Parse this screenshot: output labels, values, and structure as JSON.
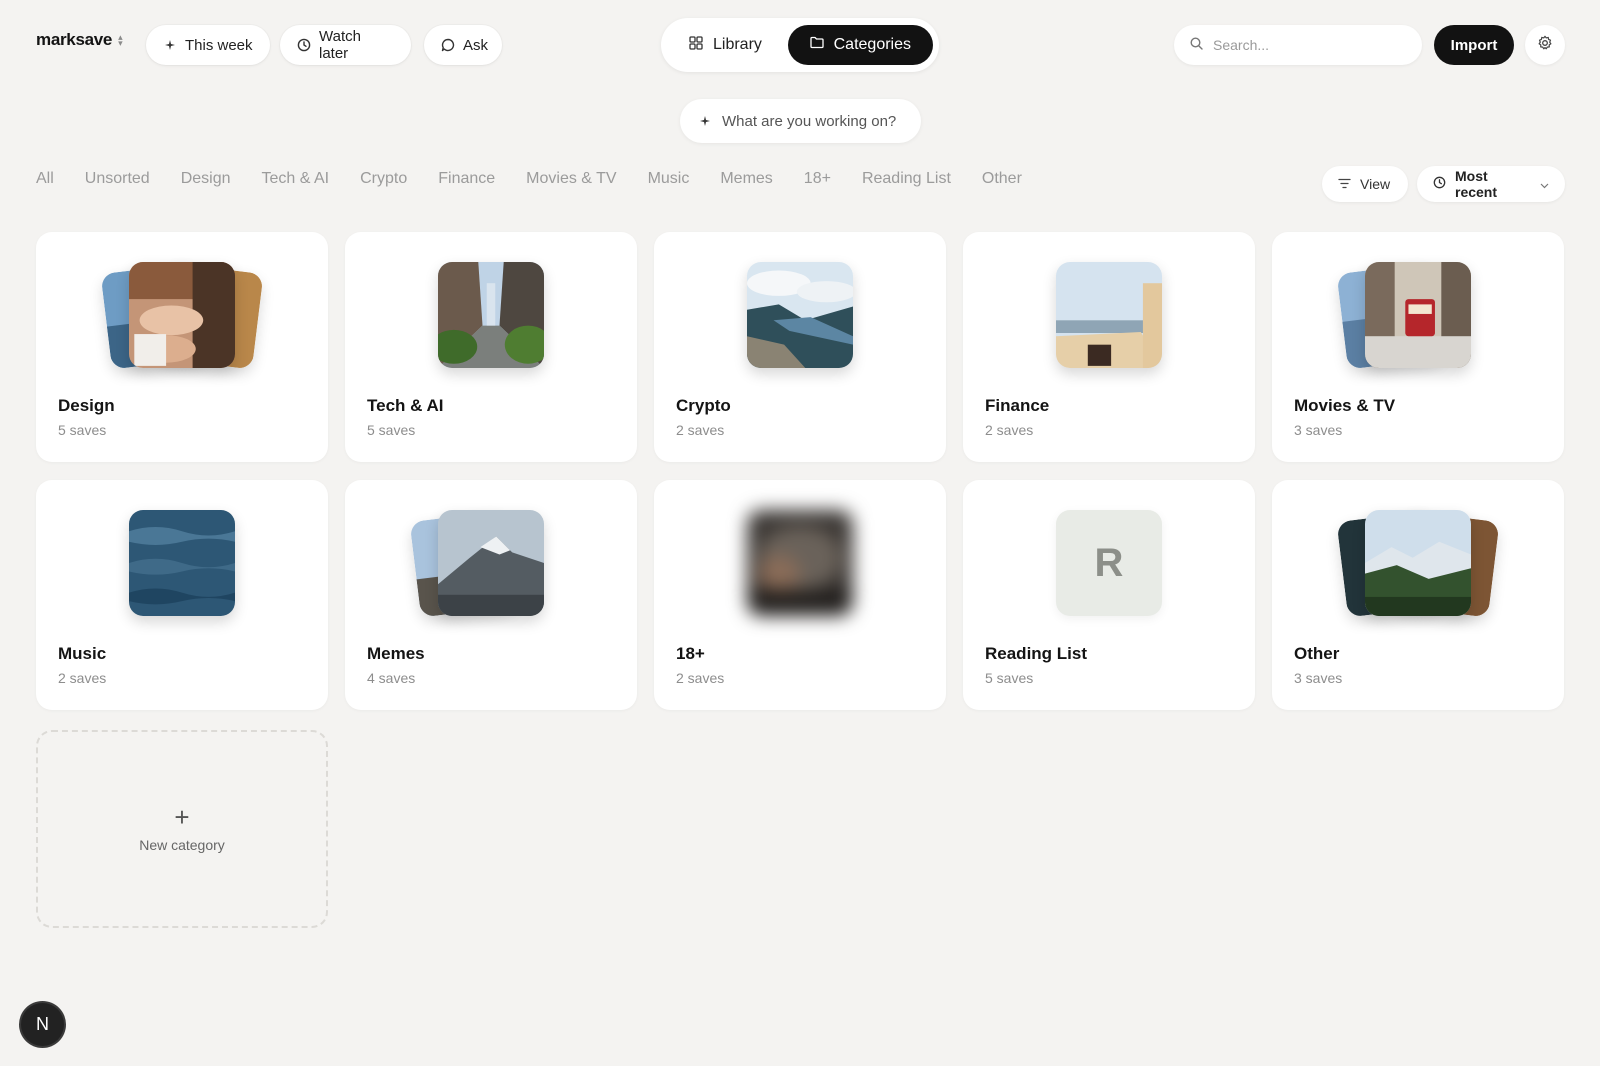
{
  "brand": {
    "name": "marksave"
  },
  "nav": {
    "this_week": "This week",
    "watch_later": "Watch later",
    "ask": "Ask"
  },
  "view_switch": {
    "library": "Library",
    "categories": "Categories",
    "active": "categories"
  },
  "search": {
    "placeholder": "Search..."
  },
  "actions": {
    "import": "Import"
  },
  "prompt": {
    "text": "What are you working on?"
  },
  "filters": [
    "All",
    "Unsorted",
    "Design",
    "Tech & AI",
    "Crypto",
    "Finance",
    "Movies & TV",
    "Music",
    "Memes",
    "18+",
    "Reading List",
    "Other"
  ],
  "toolbar": {
    "view": "View",
    "sort": "Most recent"
  },
  "categories": [
    {
      "title": "Design",
      "count": "5 saves"
    },
    {
      "title": "Tech & AI",
      "count": "5 saves"
    },
    {
      "title": "Crypto",
      "count": "2 saves"
    },
    {
      "title": "Finance",
      "count": "2 saves"
    },
    {
      "title": "Movies & TV",
      "count": "3 saves"
    },
    {
      "title": "Music",
      "count": "2 saves"
    },
    {
      "title": "Memes",
      "count": "4 saves"
    },
    {
      "title": "18+",
      "count": "2 saves"
    },
    {
      "title": "Reading List",
      "count": "5 saves",
      "letter": "R"
    },
    {
      "title": "Other",
      "count": "3 saves"
    }
  ],
  "new_category": {
    "label": "New category"
  },
  "avatar": {
    "initial": "N"
  }
}
